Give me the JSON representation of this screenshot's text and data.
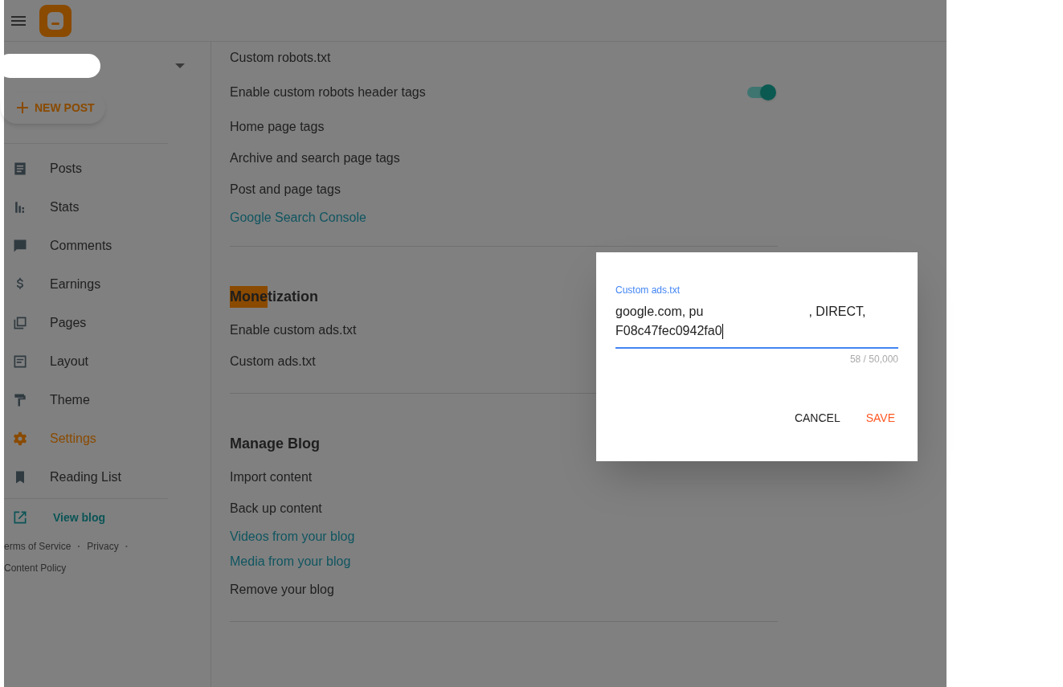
{
  "sidebar": {
    "new_post": "NEW POST",
    "items": [
      {
        "label": "Posts",
        "kind": "posts",
        "selected": false
      },
      {
        "label": "Stats",
        "kind": "stats",
        "selected": false
      },
      {
        "label": "Comments",
        "kind": "comments",
        "selected": false
      },
      {
        "label": "Earnings",
        "kind": "earnings",
        "selected": false
      },
      {
        "label": "Pages",
        "kind": "pages",
        "selected": false
      },
      {
        "label": "Layout",
        "kind": "layout",
        "selected": false
      },
      {
        "label": "Theme",
        "kind": "theme",
        "selected": false
      },
      {
        "label": "Settings",
        "kind": "settings",
        "selected": true
      },
      {
        "label": "Reading List",
        "kind": "reading",
        "selected": false
      }
    ],
    "view_blog": "View blog",
    "footer": [
      {
        "kind": "link",
        "text": "erms of Service"
      },
      {
        "kind": "separator",
        "text": "·"
      },
      {
        "kind": "link",
        "text": "Privacy"
      },
      {
        "kind": "separator",
        "text": "·"
      },
      {
        "kind": "link",
        "text": "Content Policy"
      }
    ]
  },
  "sections": [
    {
      "rows": [
        {
          "kind": "text",
          "label": "Custom robots.txt"
        },
        {
          "kind": "toggle",
          "label": "Enable custom robots header tags",
          "on": true
        },
        {
          "kind": "text",
          "label": "Home page tags"
        },
        {
          "kind": "text",
          "label": "Archive and search page tags"
        },
        {
          "kind": "text",
          "label": "Post and page tags"
        },
        {
          "kind": "link",
          "label": "Google Search Console"
        }
      ]
    },
    {
      "title_parts": [
        {
          "text": "Mone",
          "highlighted": true
        },
        {
          "text": "tization",
          "highlighted": false
        }
      ],
      "rows": [
        {
          "kind": "text",
          "label": "Enable custom ads.txt"
        },
        {
          "kind": "text",
          "label": "Custom ads.txt"
        }
      ]
    },
    {
      "title_parts": [
        {
          "text": "Manage Blog",
          "highlighted": false
        }
      ],
      "rows": [
        {
          "kind": "text",
          "label": "Import content"
        },
        {
          "kind": "text",
          "label": "Back up content"
        },
        {
          "kind": "link",
          "label": "Videos from your blog"
        },
        {
          "kind": "link",
          "label": "Media from your blog"
        },
        {
          "kind": "text",
          "label": "Remove your blog"
        }
      ]
    }
  ],
  "dialog": {
    "field_label": "Custom ads.txt",
    "value_before": "google.com, pu",
    "value_after": ", DIRECT,",
    "value_line2": "F08c47fec0942fa0",
    "counter": "58 / 50,000",
    "buttons": [
      {
        "label": "CANCEL",
        "kind": "secondary"
      },
      {
        "label": "SAVE",
        "kind": "primary"
      }
    ]
  }
}
